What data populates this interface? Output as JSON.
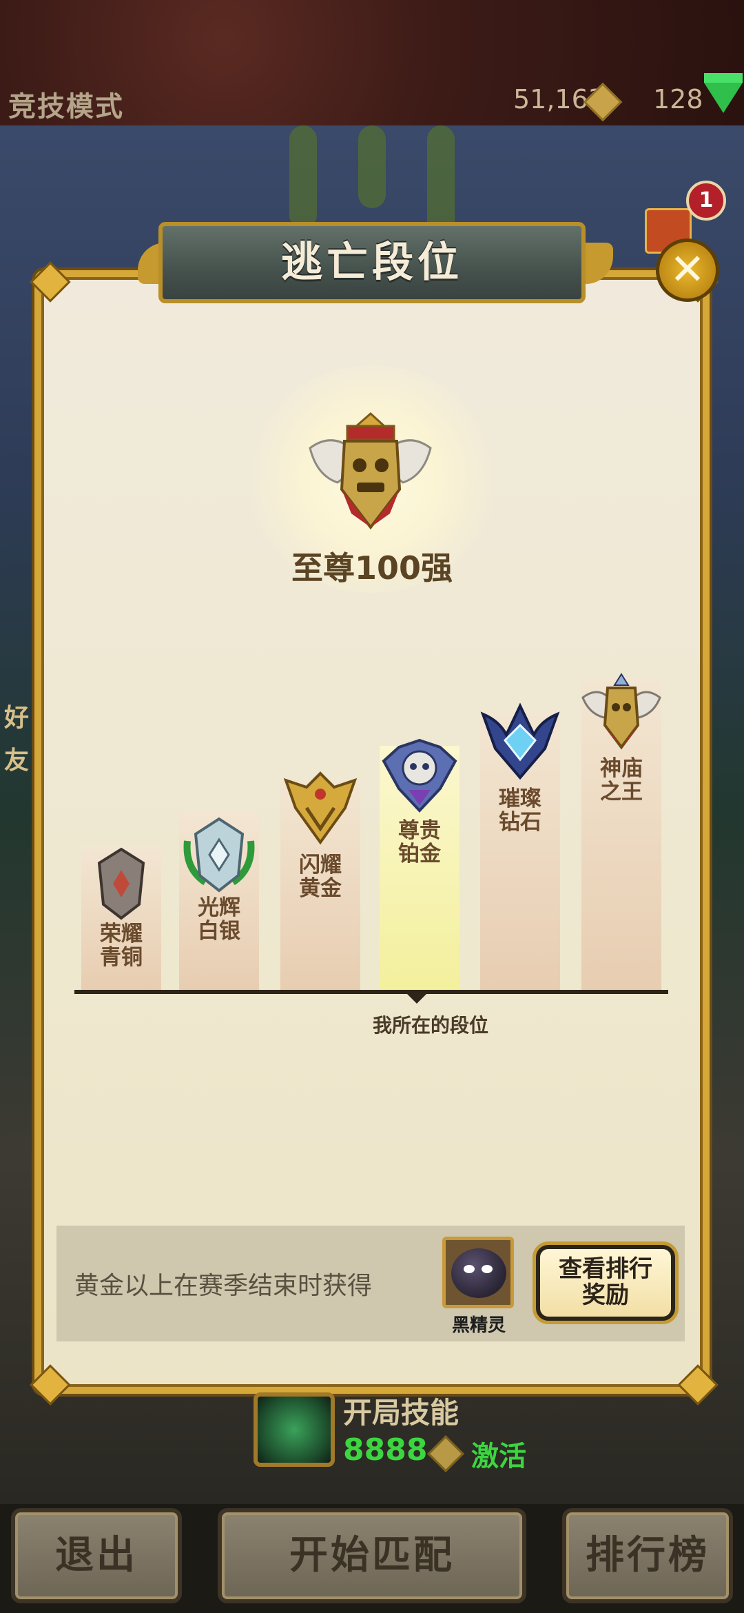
{
  "topbar": {
    "mode_title": "竞技模式",
    "gold": "51,163",
    "gems": "128"
  },
  "side": {
    "friends_label": [
      "好",
      "友"
    ]
  },
  "notification": {
    "count": "1"
  },
  "modal": {
    "title": "逃亡段位",
    "close_icon": "close-icon",
    "top_rank": {
      "name": "至尊100强"
    },
    "tiers": [
      {
        "label": "荣耀\n青铜",
        "icon": "bronze-emblem-icon"
      },
      {
        "label": "光辉\n白银",
        "icon": "silver-emblem-icon"
      },
      {
        "label": "闪耀\n黄金",
        "icon": "gold-emblem-icon"
      },
      {
        "label": "尊贵\n铂金",
        "icon": "platinum-emblem-icon",
        "current": true
      },
      {
        "label": "璀璨\n钻石",
        "icon": "diamond-emblem-icon"
      },
      {
        "label": "神庙\n之王",
        "icon": "temple-king-emblem-icon"
      }
    ],
    "my_tier_label": "我所在的段位",
    "reward": {
      "text": "黄金以上在赛季结束时获得",
      "pet_name": "黑精灵",
      "button_label": "查看排行\n奖励"
    }
  },
  "skill": {
    "title": "开局技能",
    "cost": "8888",
    "action": "激活"
  },
  "bottom": {
    "exit": "退出",
    "match": "开始匹配",
    "leaderboard": "排行榜"
  },
  "colors": {
    "accent_gold": "#d6a83a",
    "panel_bg": "#eee8cf",
    "current_tier": "#f3f09d",
    "green": "#3bd640"
  }
}
